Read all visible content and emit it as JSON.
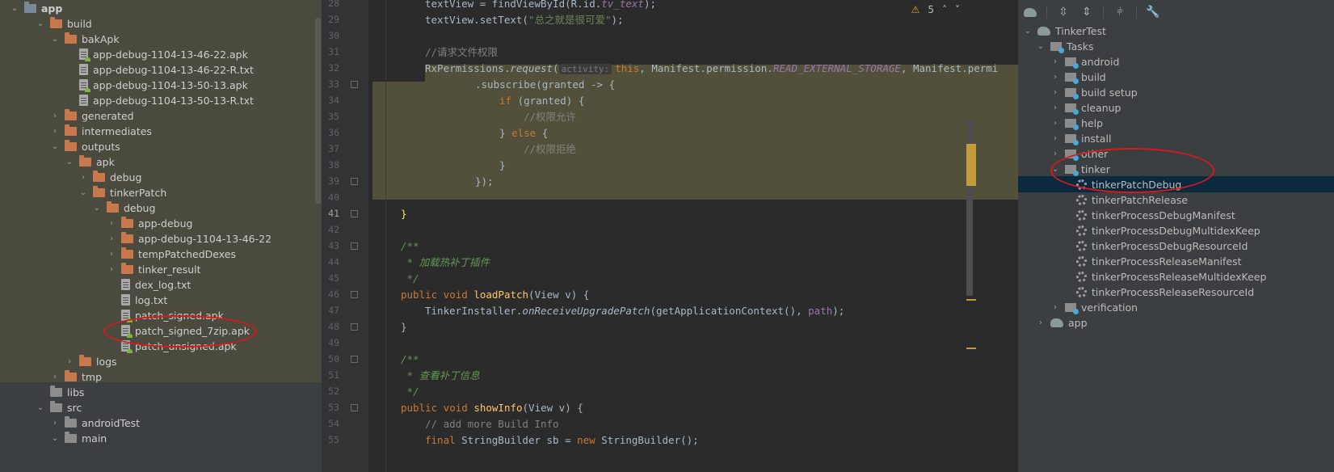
{
  "project_tree": {
    "items": [
      {
        "label": "app",
        "level": 1,
        "icon": "module-folder-icon",
        "expanded": true,
        "bold": true
      },
      {
        "label": "build",
        "level": 2,
        "icon": "folder-icon",
        "expanded": true
      },
      {
        "label": "bakApk",
        "level": 3,
        "icon": "folder-icon",
        "expanded": true
      },
      {
        "label": "app-debug-1104-13-46-22.apk",
        "level": 4,
        "icon": "apk-file-icon"
      },
      {
        "label": "app-debug-1104-13-46-22-R.txt",
        "level": 4,
        "icon": "text-file-icon"
      },
      {
        "label": "app-debug-1104-13-50-13.apk",
        "level": 4,
        "icon": "apk-file-icon"
      },
      {
        "label": "app-debug-1104-13-50-13-R.txt",
        "level": 4,
        "icon": "text-file-icon"
      },
      {
        "label": "generated",
        "level": 3,
        "icon": "folder-icon",
        "expanded": false
      },
      {
        "label": "intermediates",
        "level": 3,
        "icon": "folder-icon",
        "expanded": false
      },
      {
        "label": "outputs",
        "level": 3,
        "icon": "folder-icon",
        "expanded": true
      },
      {
        "label": "apk",
        "level": 4,
        "icon": "folder-icon",
        "expanded": true
      },
      {
        "label": "debug",
        "level": 5,
        "icon": "folder-icon",
        "expanded": false
      },
      {
        "label": "tinkerPatch",
        "level": 5,
        "icon": "folder-icon",
        "expanded": true
      },
      {
        "label": "debug",
        "level": 6,
        "icon": "folder-icon",
        "expanded": true
      },
      {
        "label": "app-debug",
        "level": 7,
        "icon": "folder-icon",
        "expanded": false
      },
      {
        "label": "app-debug-1104-13-46-22",
        "level": 7,
        "icon": "folder-icon",
        "expanded": false
      },
      {
        "label": "tempPatchedDexes",
        "level": 7,
        "icon": "folder-icon",
        "expanded": false
      },
      {
        "label": "tinker_result",
        "level": 7,
        "icon": "folder-icon",
        "expanded": false
      },
      {
        "label": "dex_log.txt",
        "level": 7,
        "icon": "text-file-icon"
      },
      {
        "label": "log.txt",
        "level": 7,
        "icon": "text-file-icon"
      },
      {
        "label": "patch_signed.apk",
        "level": 7,
        "icon": "apk-file-icon"
      },
      {
        "label": "patch_signed_7zip.apk",
        "level": 7,
        "icon": "apk-file-icon"
      },
      {
        "label": "patch_unsigned.apk",
        "level": 7,
        "icon": "apk-file-icon"
      },
      {
        "label": "logs",
        "level": 4,
        "icon": "folder-icon",
        "expanded": false
      },
      {
        "label": "tmp",
        "level": 3,
        "icon": "folder-icon",
        "expanded": false
      },
      {
        "label": "libs",
        "level": 2,
        "icon": "folder-icon",
        "grey": true
      },
      {
        "label": "src",
        "level": 2,
        "icon": "folder-icon",
        "expanded": true,
        "grey": true
      },
      {
        "label": "androidTest",
        "level": 3,
        "icon": "folder-icon",
        "expanded": false,
        "grey": true
      },
      {
        "label": "main",
        "level": 3,
        "icon": "folder-icon",
        "expanded": true,
        "grey": true
      }
    ]
  },
  "editor": {
    "line_numbers": [
      "28",
      "29",
      "30",
      "31",
      "32",
      "33",
      "34",
      "35",
      "36",
      "37",
      "38",
      "39",
      "40",
      "41",
      "42",
      "43",
      "44",
      "45",
      "46",
      "47",
      "48",
      "49",
      "50",
      "51",
      "52",
      "53",
      "54",
      "55"
    ],
    "current_line": "41",
    "warnings_count": "5",
    "code": {
      "l28": "textView = findViewById(R.id.",
      "l28b": "tv_text",
      "l28c": ");",
      "l29a": "textView.setText(",
      "l29s": "\"总之就是很可爱\"",
      "l29c": ");",
      "l31": "//请求文件权限",
      "l32a": "RxPermissions.",
      "l32fn": "request",
      "l32b": "(",
      "l32hint": "activity:",
      "l32this": "this",
      "l32c": ", Manifest.permission.",
      "l32f1": "READ_EXTERNAL_STORAGE",
      "l32d": ", Manifest.permi",
      "l33": ".subscribe(granted -> {",
      "l34k": "if",
      "l34": " (granted) {",
      "l35": "//权限允许",
      "l36a": "} ",
      "l36k": "else",
      "l36b": " {",
      "l37": "//权限拒绝",
      "l38": "}",
      "l39": "});",
      "l41": "}",
      "l43": "/**",
      "l44": " * 加载热补丁插件",
      "l45": " */",
      "l46k": "public void ",
      "l46fn": "loadPatch",
      "l46": "(View v) {",
      "l47a": "TinkerInstaller.",
      "l47fn": "onReceiveUpgradePatch",
      "l47b": "(getApplicationContext(), ",
      "l47f": "path",
      "l47c": ");",
      "l48": "}",
      "l50": "/**",
      "l51": " * 查看补丁信息",
      "l52": " */",
      "l53k": "public void ",
      "l53fn": "showInfo",
      "l53": "(View v) {",
      "l54": "// add more Build Info",
      "l55k": "final ",
      "l55a": "StringBuilder sb = ",
      "l55k2": "new ",
      "l55b": "StringBuilder();"
    }
  },
  "gradle": {
    "toolbar_icons": [
      "elephant-icon",
      "expand-all-icon",
      "collapse-all-icon",
      "link-icon",
      "wrench-icon"
    ],
    "items": [
      {
        "label": "TinkerTest",
        "level": 1,
        "icon": "elephant-icon",
        "expanded": true
      },
      {
        "label": "Tasks",
        "level": 2,
        "icon": "task-folder-icon",
        "expanded": true
      },
      {
        "label": "android",
        "level": 3,
        "icon": "task-folder-icon",
        "expanded": false
      },
      {
        "label": "build",
        "level": 3,
        "icon": "task-folder-icon",
        "expanded": false
      },
      {
        "label": "build setup",
        "level": 3,
        "icon": "task-folder-icon",
        "expanded": false
      },
      {
        "label": "cleanup",
        "level": 3,
        "icon": "task-folder-icon",
        "expanded": false
      },
      {
        "label": "help",
        "level": 3,
        "icon": "task-folder-icon",
        "expanded": false
      },
      {
        "label": "install",
        "level": 3,
        "icon": "task-folder-icon",
        "expanded": false
      },
      {
        "label": "other",
        "level": 3,
        "icon": "task-folder-icon",
        "expanded": false
      },
      {
        "label": "tinker",
        "level": 3,
        "icon": "task-folder-icon",
        "expanded": true
      },
      {
        "label": "tinkerPatchDebug",
        "level": 4,
        "icon": "gear-icon",
        "selected": true
      },
      {
        "label": "tinkerPatchRelease",
        "level": 4,
        "icon": "gear-icon"
      },
      {
        "label": "tinkerProcessDebugManifest",
        "level": 4,
        "icon": "gear-icon"
      },
      {
        "label": "tinkerProcessDebugMultidexKeep",
        "level": 4,
        "icon": "gear-icon"
      },
      {
        "label": "tinkerProcessDebugResourceId",
        "level": 4,
        "icon": "gear-icon"
      },
      {
        "label": "tinkerProcessReleaseManifest",
        "level": 4,
        "icon": "gear-icon"
      },
      {
        "label": "tinkerProcessReleaseMultidexKeep",
        "level": 4,
        "icon": "gear-icon"
      },
      {
        "label": "tinkerProcessReleaseResourceId",
        "level": 4,
        "icon": "gear-icon"
      },
      {
        "label": "verification",
        "level": 3,
        "icon": "task-folder-icon",
        "expanded": false
      },
      {
        "label": "app",
        "level": 2,
        "icon": "elephant-icon",
        "expanded": false
      }
    ]
  },
  "colors": {
    "annotation_ring": "#d51b1b",
    "selection": "#0d293e",
    "highlight": "#52503a"
  }
}
